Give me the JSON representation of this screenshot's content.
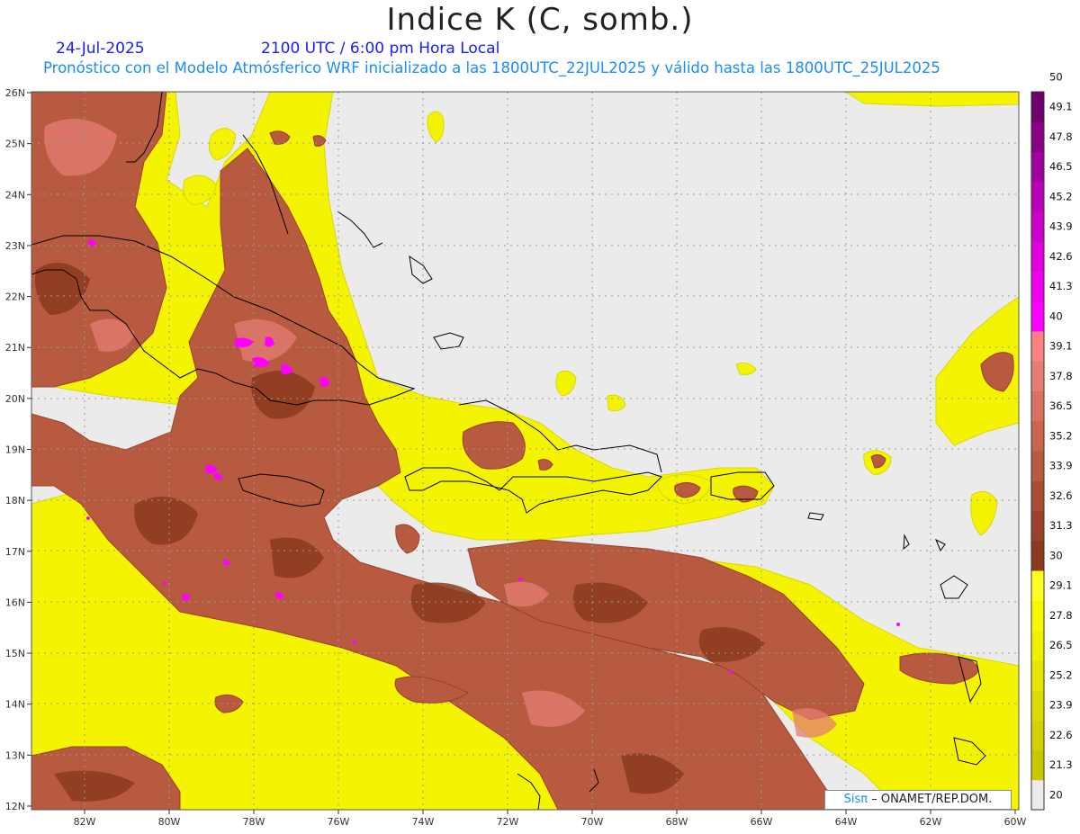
{
  "header": {
    "title": "Indice K (C, somb.)",
    "date": "24-Jul-2025",
    "time": "2100 UTC / 6:00 pm Hora Local",
    "forecast": "Pronóstico con el Modelo Atmósferico WRF inicializado a las 1800UTC_22JUL2025 y válido hasta las  1800UTC_25JUL2025"
  },
  "axes": {
    "lat_labels": [
      "12N",
      "13N",
      "14N",
      "15N",
      "16N",
      "17N",
      "18N",
      "19N",
      "20N",
      "21N",
      "22N",
      "23N",
      "24N",
      "25N",
      "26N"
    ],
    "lon_labels": [
      "82W",
      "80W",
      "78W",
      "76W",
      "74W",
      "72W",
      "70W",
      "68W",
      "66W",
      "64W",
      "62W",
      "60W"
    ]
  },
  "colorbar": {
    "levels": [
      "20",
      "21.3",
      "22.6",
      "23.9",
      "25.2",
      "26.5",
      "27.8",
      "29.1",
      "30",
      "31.3",
      "32.6",
      "33.9",
      "35.2",
      "36.5",
      "37.8",
      "39.1",
      "40",
      "41.3",
      "42.6",
      "43.9",
      "45.2",
      "46.5",
      "47.8",
      "49.1",
      "50"
    ],
    "colors": {
      "below": "#ebebeb",
      "yellow": [
        "#c8c800",
        "#d2d200",
        "#dcdc00",
        "#e6e600",
        "#f0f000",
        "#f8f800",
        "#ffff20"
      ],
      "brown": [
        "#8b3a1e",
        "#99412a",
        "#a84c34",
        "#b85a40",
        "#c7654e",
        "#d87060",
        "#e47d74"
      ],
      "pink": [
        "#ff8080",
        "#ff00ff",
        "#f000f0",
        "#e000e0",
        "#cc00cc",
        "#b800b8",
        "#a000a0",
        "#880088",
        "#6e006e"
      ]
    }
  },
  "credit": {
    "sis": "Sisπ",
    "org": "– ONAMET/REP.DOM."
  }
}
